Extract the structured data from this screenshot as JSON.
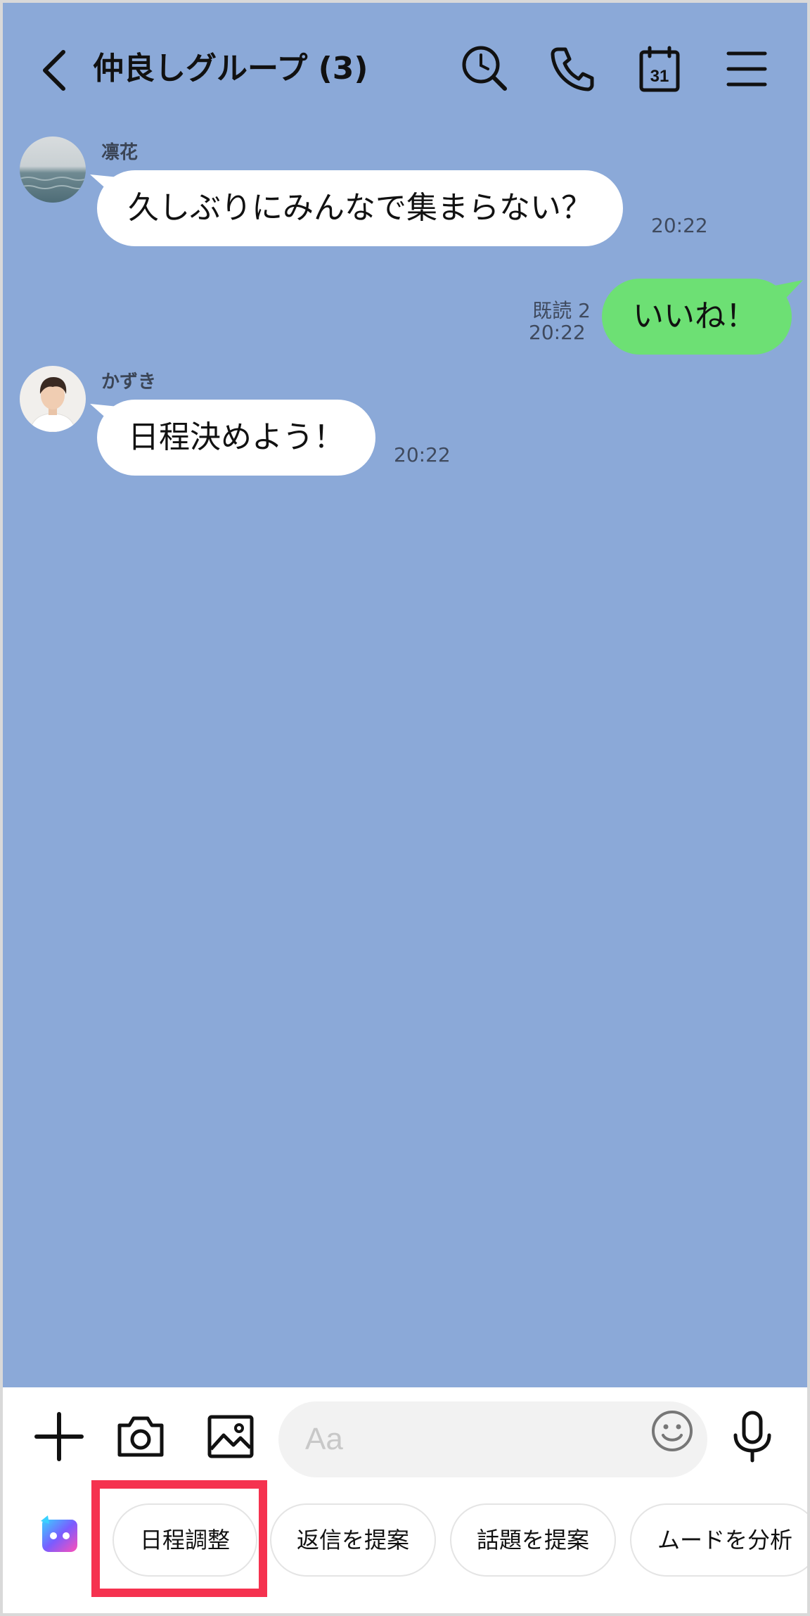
{
  "header": {
    "back_label": "",
    "title": "仲良しグループ (3)",
    "icons": [
      "back-chevron-icon",
      "search-history-icon",
      "phone-icon",
      "calendar-icon",
      "menu-icon"
    ],
    "calendar_day": "31"
  },
  "messages": [
    {
      "sender": "凛花",
      "text": "久しぶりにみんなで集まらない？",
      "time": "20:22",
      "direction": "in"
    },
    {
      "sender": "",
      "text": "いいね！",
      "time": "20:22",
      "read_receipt": "既読 2",
      "direction": "out"
    },
    {
      "sender": "かずき",
      "text": "日程決めよう！",
      "time": "20:22",
      "direction": "in"
    }
  ],
  "input_bar": {
    "placeholder": "Aa",
    "icons": [
      "plus-icon",
      "camera-icon",
      "image-icon",
      "emoji-icon",
      "microphone-icon"
    ]
  },
  "suggestions": {
    "icon": "ai-assistant-icon",
    "chips": [
      "日程調整",
      "返信を提案",
      "話題を提案",
      "ムードを分析"
    ]
  },
  "colors": {
    "chat_background": "#8ba9d8",
    "incoming_bubble": "#ffffff",
    "outgoing_bubble": "#6de074",
    "highlight": "#f5324f"
  }
}
